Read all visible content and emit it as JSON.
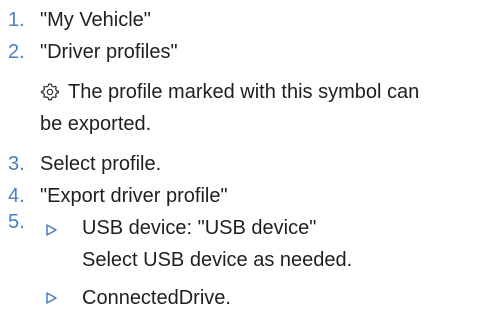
{
  "steps": [
    {
      "number": "1.",
      "text": "\"My Vehicle\""
    },
    {
      "number": "2.",
      "text": "\"Driver profiles\"",
      "note_line1": "The profile marked with this symbol can",
      "note_line2": "be exported.",
      "note_icon": "gear-icon"
    },
    {
      "number": "3.",
      "text": "Select profile."
    },
    {
      "number": "4.",
      "text": "\"Export driver profile\""
    },
    {
      "number": "5.",
      "options": [
        {
          "bullet_icon": "triangle-right-icon",
          "text": "USB device: \"USB device\"",
          "detail": "Select USB device as needed."
        },
        {
          "bullet_icon": "triangle-right-icon",
          "text": "ConnectedDrive."
        }
      ]
    }
  ],
  "colors": {
    "number_color": "#4a7fc1",
    "text_color": "#1f1f1f"
  }
}
